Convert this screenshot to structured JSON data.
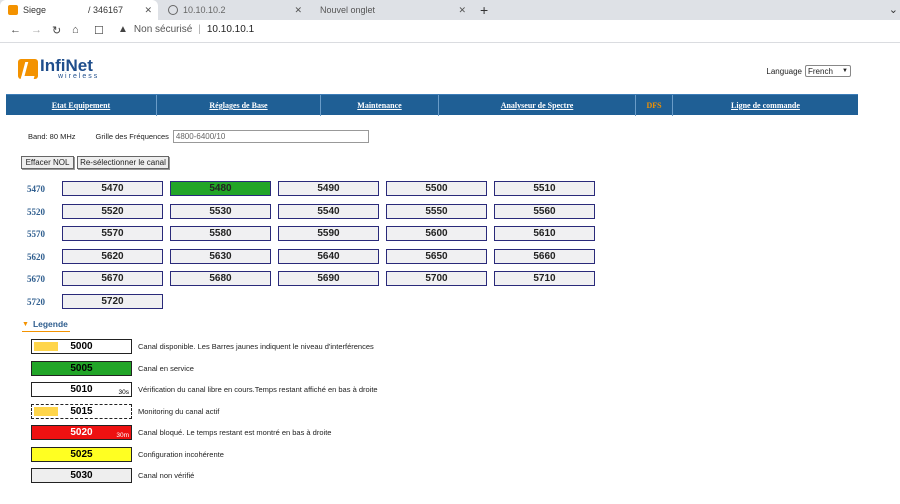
{
  "browser": {
    "tabs": [
      {
        "title": "Siege",
        "subtitle": "/ 346167",
        "active": true
      },
      {
        "title": "10.10.10.2",
        "active": false
      },
      {
        "title": "Nouvel onglet",
        "active": false
      }
    ],
    "new_tab_label": "+",
    "not_secure_label": "Non sécurisé",
    "url": "10.10.10.1"
  },
  "header": {
    "brand": "InfiNet",
    "brand_sub": "wireless",
    "language_label": "Language",
    "language_value": "French"
  },
  "menu": [
    {
      "label": "Etat Equipement"
    },
    {
      "label": "Réglages de Base"
    },
    {
      "label": "Maintenance"
    },
    {
      "label": "Analyseur de Spectre"
    },
    {
      "label": "DFS"
    },
    {
      "label": "Ligne de commande"
    }
  ],
  "band": {
    "band_label": "Band: 80 MHz",
    "grid_label": "Grille des Fréquences",
    "grid_value": "4800-6400/10"
  },
  "buttons": {
    "clear_nol": "Effacer NOL",
    "reselect": "Re-sélectionner le canal"
  },
  "channel_rows": [
    {
      "label": "5470",
      "channels": [
        "5470",
        "5480",
        "5490",
        "5500",
        "5510"
      ]
    },
    {
      "label": "5520",
      "channels": [
        "5520",
        "5530",
        "5540",
        "5550",
        "5560"
      ]
    },
    {
      "label": "5570",
      "channels": [
        "5570",
        "5580",
        "5590",
        "5600",
        "5610"
      ]
    },
    {
      "label": "5620",
      "channels": [
        "5620",
        "5630",
        "5640",
        "5650",
        "5660"
      ]
    },
    {
      "label": "5670",
      "channels": [
        "5670",
        "5680",
        "5690",
        "5700",
        "5710"
      ]
    },
    {
      "label": "5720",
      "channels": [
        "5720"
      ]
    }
  ],
  "in_service_channel": "5480",
  "legend": {
    "title": "Legende",
    "items": [
      {
        "value": "5000",
        "desc": "Canal disponible. Les Barres jaunes indiquent le niveau d'interférences",
        "bg": "#ffffff",
        "bar": true,
        "time": "",
        "dashed": false,
        "color": "#000000"
      },
      {
        "value": "5005",
        "desc": "Canal en service",
        "bg": "#22a528",
        "bar": false,
        "time": "",
        "dashed": false,
        "color": "#000000"
      },
      {
        "value": "5010",
        "desc": "Vérification du canal libre en cours.Temps restant affiché en bas à droite",
        "bg": "#ffffff",
        "bar": false,
        "time": "30s",
        "dashed": false,
        "color": "#000000"
      },
      {
        "value": "5015",
        "desc": "Monitoring du canal actif",
        "bg": "#ffffff",
        "bar": true,
        "time": "",
        "dashed": true,
        "color": "#000000"
      },
      {
        "value": "5020",
        "desc": "Canal bloqué. Le temps restant est montré en bas à droite",
        "bg": "#ee1111",
        "bar": false,
        "time": "30m",
        "dashed": false,
        "color": "#ffffff"
      },
      {
        "value": "5025",
        "desc": "Configuration incohérente",
        "bg": "#ffff22",
        "bar": false,
        "time": "",
        "dashed": false,
        "color": "#000000"
      },
      {
        "value": "5030",
        "desc": "Canal non vérifié",
        "bg": "#eeeeee",
        "bar": false,
        "time": "",
        "dashed": false,
        "color": "#000000"
      }
    ]
  },
  "colors": {
    "menu_bg": "#1f5f95",
    "accent": "#f39200",
    "in_service": "#22a528"
  }
}
